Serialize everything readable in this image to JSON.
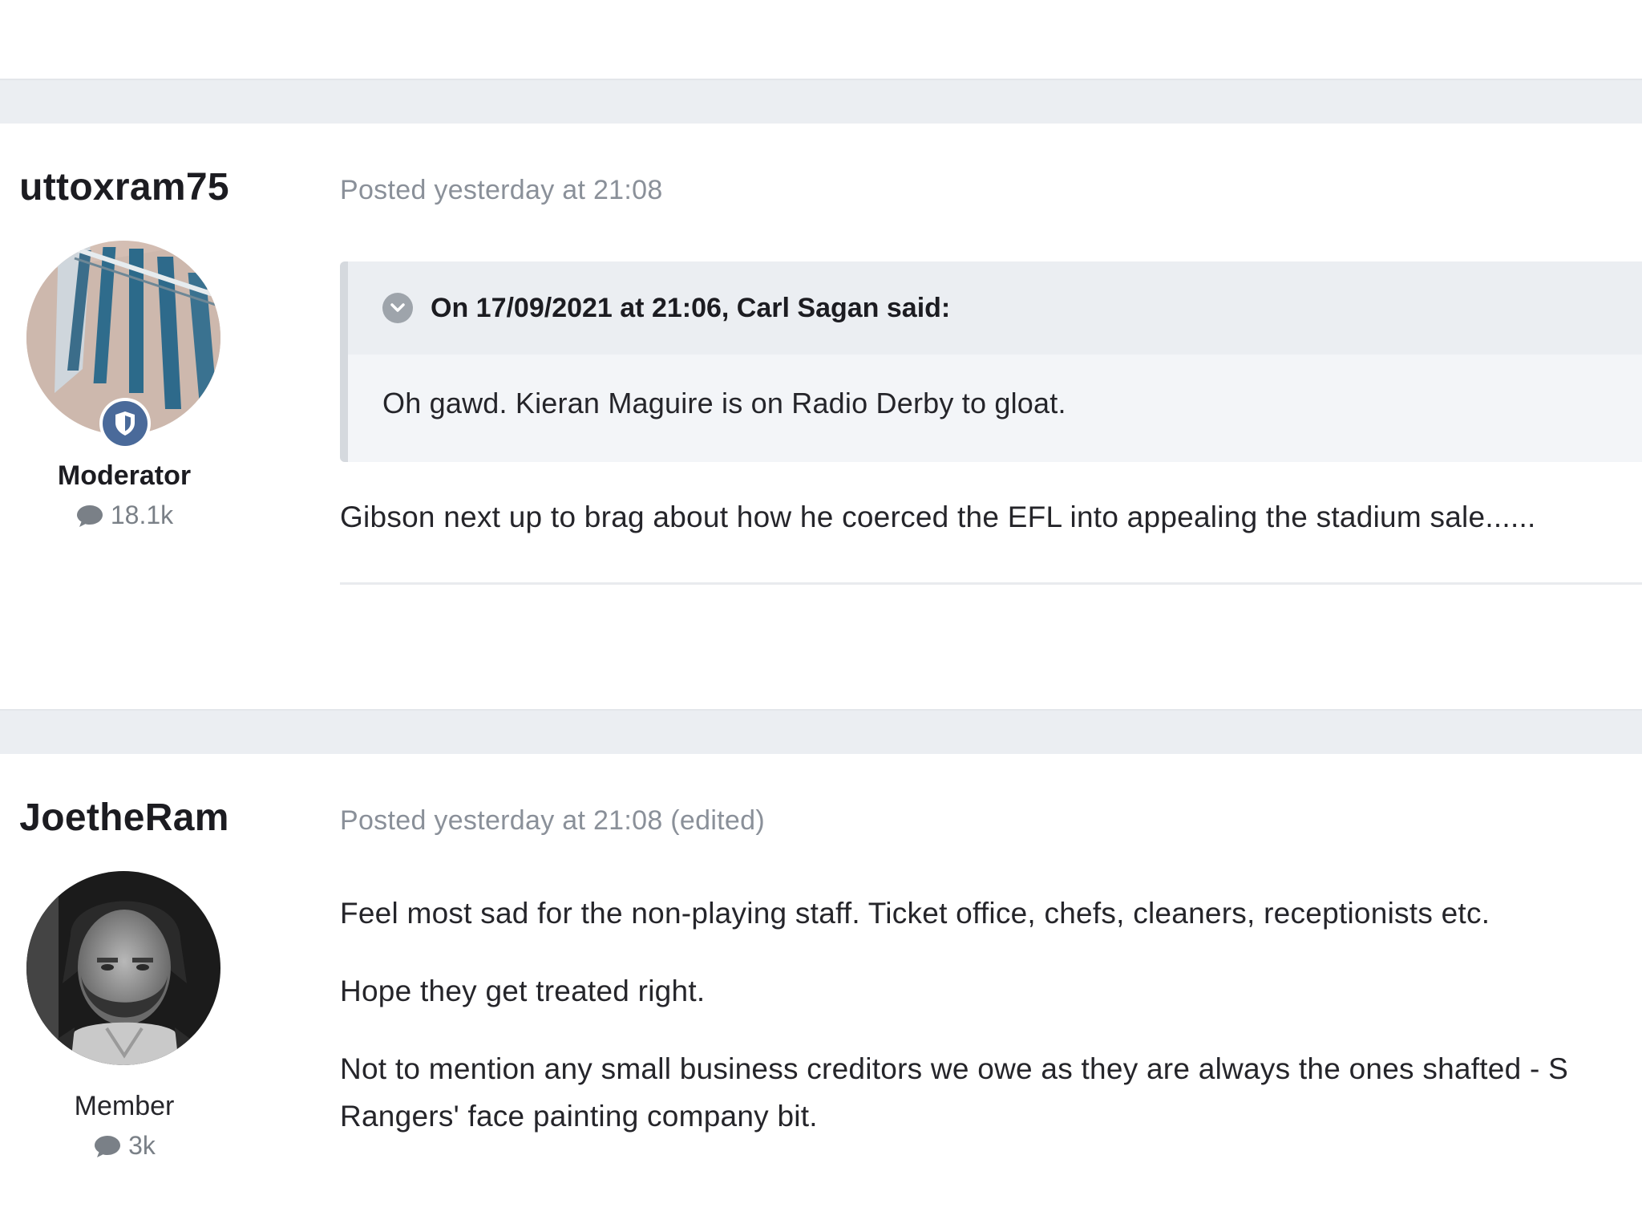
{
  "posts": [
    {
      "author": "uttoxram75",
      "role": "Moderator",
      "post_count": "18.1k",
      "meta": "Posted yesterday at 21:08",
      "quote": {
        "citation": "On 17/09/2021 at 21:06, Carl Sagan said:",
        "text": "Oh gawd. Kieran Maguire is on Radio Derby to gloat."
      },
      "paragraphs": [
        "Gibson next up to brag about how he coerced the EFL into appealing the stadium sale......"
      ]
    },
    {
      "author": "JoetheRam",
      "role": "Member",
      "post_count": "3k",
      "meta": "Posted yesterday at 21:08 (edited)",
      "paragraphs": [
        "Feel most sad for the non-playing staff. Ticket office, chefs, cleaners, receptionists etc.",
        "Hope they get treated right.",
        "Not to mention any small business creditors we owe as they are always the ones shafted - S",
        "Rangers' face painting company bit."
      ]
    }
  ],
  "colors": {
    "band": "#ebeef2",
    "meta_text": "#8a9099",
    "moderator_badge": "#4a6a9a",
    "quote_border": "#d5d9de"
  },
  "icons": [
    "shield-icon",
    "comment-icon",
    "chevron-down-icon"
  ]
}
